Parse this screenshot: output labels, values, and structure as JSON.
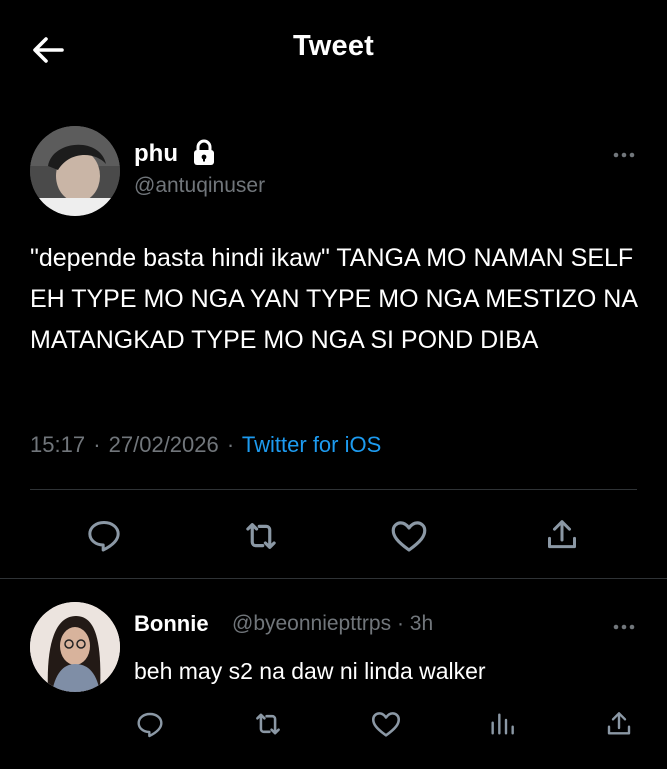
{
  "header": {
    "title": "Tweet"
  },
  "tweet": {
    "author_name": "phu",
    "author_handle": "@antuqinuser",
    "text": "\"depende basta hindi ikaw\" TANGA MO NAMAN SELF EH TYPE MO NGA YAN TYPE MO NGA MESTIZO NA MATANGKAD TYPE MO NGA SI POND DIBA",
    "time": "15:17",
    "date": "27/02/2026",
    "separator": "·",
    "source": "Twitter for iOS"
  },
  "reply": {
    "author_name": "Bonnie",
    "author_handle": "@byeonniepttrps",
    "age": "3h",
    "text": "beh may s2 na daw ni linda walker"
  },
  "icons": {
    "back": "arrow-left-icon",
    "lock": "lock-icon",
    "more": "more-horizontal-icon",
    "reply": "reply-icon",
    "retweet": "retweet-icon",
    "like": "heart-icon",
    "share": "share-icon",
    "analytics": "analytics-icon"
  },
  "colors": {
    "background": "#000000",
    "text": "#ffffff",
    "muted": "#71767b",
    "link": "#1d9bf0",
    "divider": "#2f3336"
  }
}
